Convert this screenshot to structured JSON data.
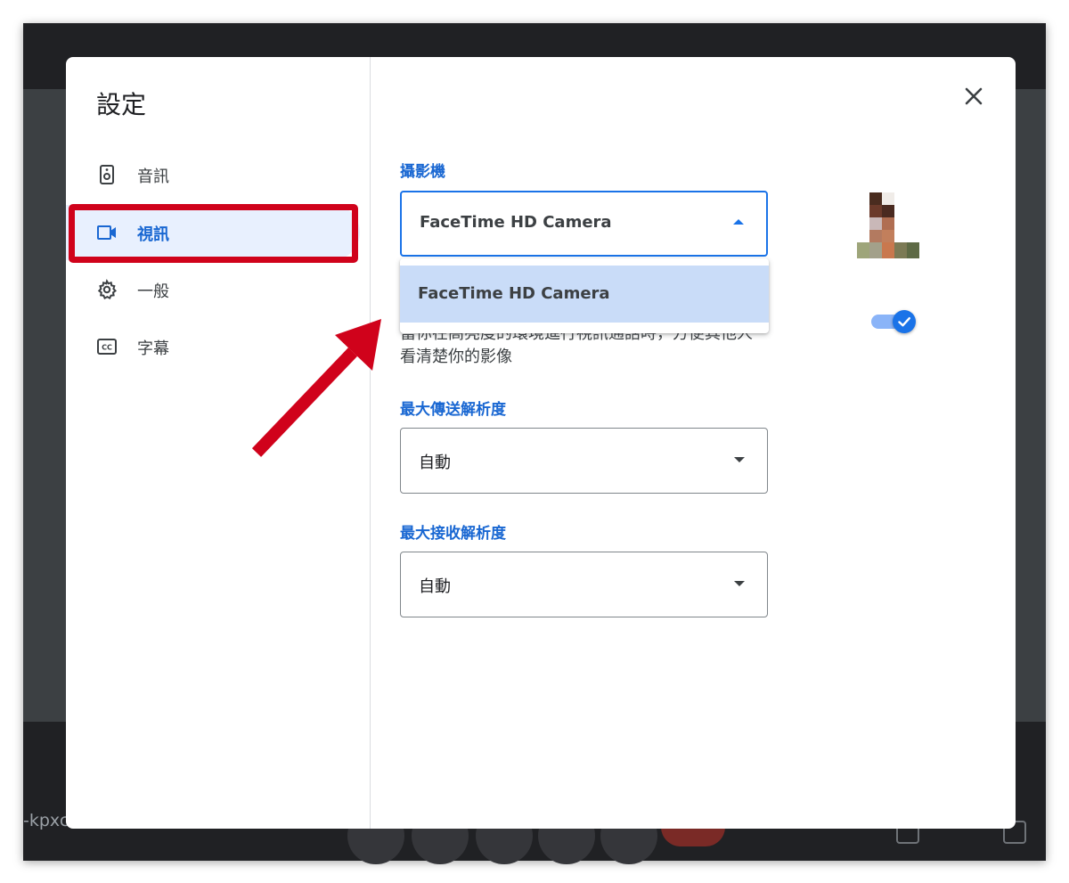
{
  "background": {
    "room_code": "-kpxc"
  },
  "dialog": {
    "title": "設定",
    "nav": [
      {
        "label": "音訊",
        "icon": "speaker-icon"
      },
      {
        "label": "視訊",
        "icon": "videocam-icon",
        "active": true
      },
      {
        "label": "一般",
        "icon": "gear-icon"
      },
      {
        "label": "字幕",
        "icon": "closed-caption-icon"
      }
    ],
    "camera": {
      "label": "攝影機",
      "selected": "FaceTime HD Camera",
      "options": [
        "FaceTime HD Camera"
      ]
    },
    "lighting_description": "當你在高亮度的環境進行視訊通話時，方便其他人看清楚你的影像",
    "lighting_toggle_on": true,
    "send_resolution": {
      "label": "最大傳送解析度",
      "value": "自動"
    },
    "receive_resolution": {
      "label": "最大接收解析度",
      "value": "自動"
    }
  },
  "colors": {
    "accent": "#1a73e8",
    "accent_text": "#1967d2",
    "nav_active_bg": "#e8f0fe",
    "annotation_red": "#d0021b",
    "option_highlight": "#c9dcf8"
  }
}
